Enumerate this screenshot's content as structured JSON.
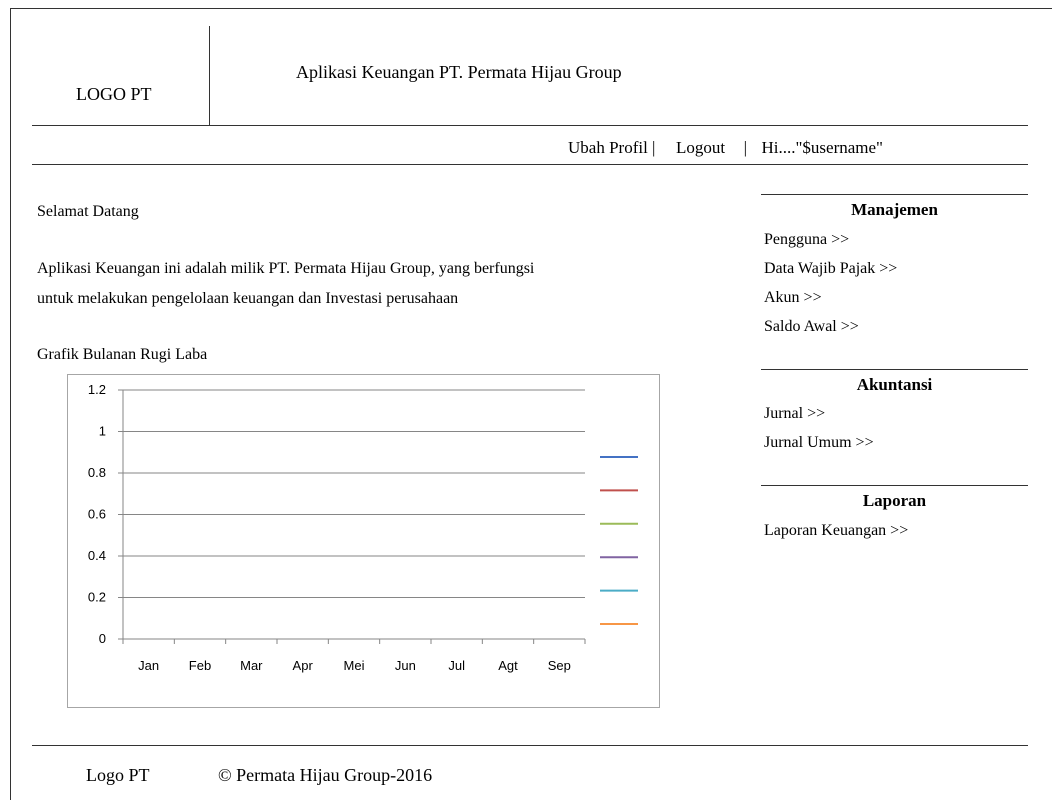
{
  "header": {
    "logo_text": "LOGO PT",
    "app_title": "Aplikasi Keuangan PT. Permata Hijau Group"
  },
  "topnav": {
    "ubah_profil": "Ubah Profil",
    "sep1": "|",
    "logout": "Logout",
    "sep2": "|",
    "greeting": "Hi....\"$username\""
  },
  "main": {
    "welcome": "Selamat Datang",
    "description_line1": "Aplikasi Keuangan ini adalah milik PT. Permata Hijau Group, yang berfungsi",
    "description_line2": "untuk melakukan pengelolaan keuangan dan Investasi perusahaan",
    "chart_title": "Grafik Bulanan Rugi Laba"
  },
  "sidebar": {
    "sections": [
      {
        "heading": "Manajemen",
        "items": [
          "Pengguna >>",
          "Data Wajib Pajak >>",
          "Akun >>",
          "Saldo Awal >>"
        ]
      },
      {
        "heading": "Akuntansi",
        "items": [
          "Jurnal >>",
          "Jurnal Umum >>"
        ]
      },
      {
        "heading": "Laporan",
        "items": [
          "Laporan Keuangan >>"
        ]
      }
    ]
  },
  "footer": {
    "logo_text": "Logo PT",
    "copyright": "© Permata Hijau Group-2016"
  },
  "chart_data": {
    "type": "line",
    "title": "",
    "categories": [
      "Jan",
      "Feb",
      "Mar",
      "Apr",
      "Mei",
      "Jun",
      "Jul",
      "Agt",
      "Sep"
    ],
    "ylim": [
      0,
      1.2
    ],
    "yticks": [
      "0",
      "0.2",
      "0.4",
      "0.6",
      "0.8",
      "1",
      "1.2"
    ],
    "grid": true,
    "legend_position": "right",
    "series": [
      {
        "color": "#4472c4",
        "values": []
      },
      {
        "color": "#c0504d",
        "values": []
      },
      {
        "color": "#9bbb59",
        "values": []
      },
      {
        "color": "#8064a2",
        "values": []
      },
      {
        "color": "#4bacc6",
        "values": []
      },
      {
        "color": "#f79646",
        "values": []
      }
    ]
  }
}
